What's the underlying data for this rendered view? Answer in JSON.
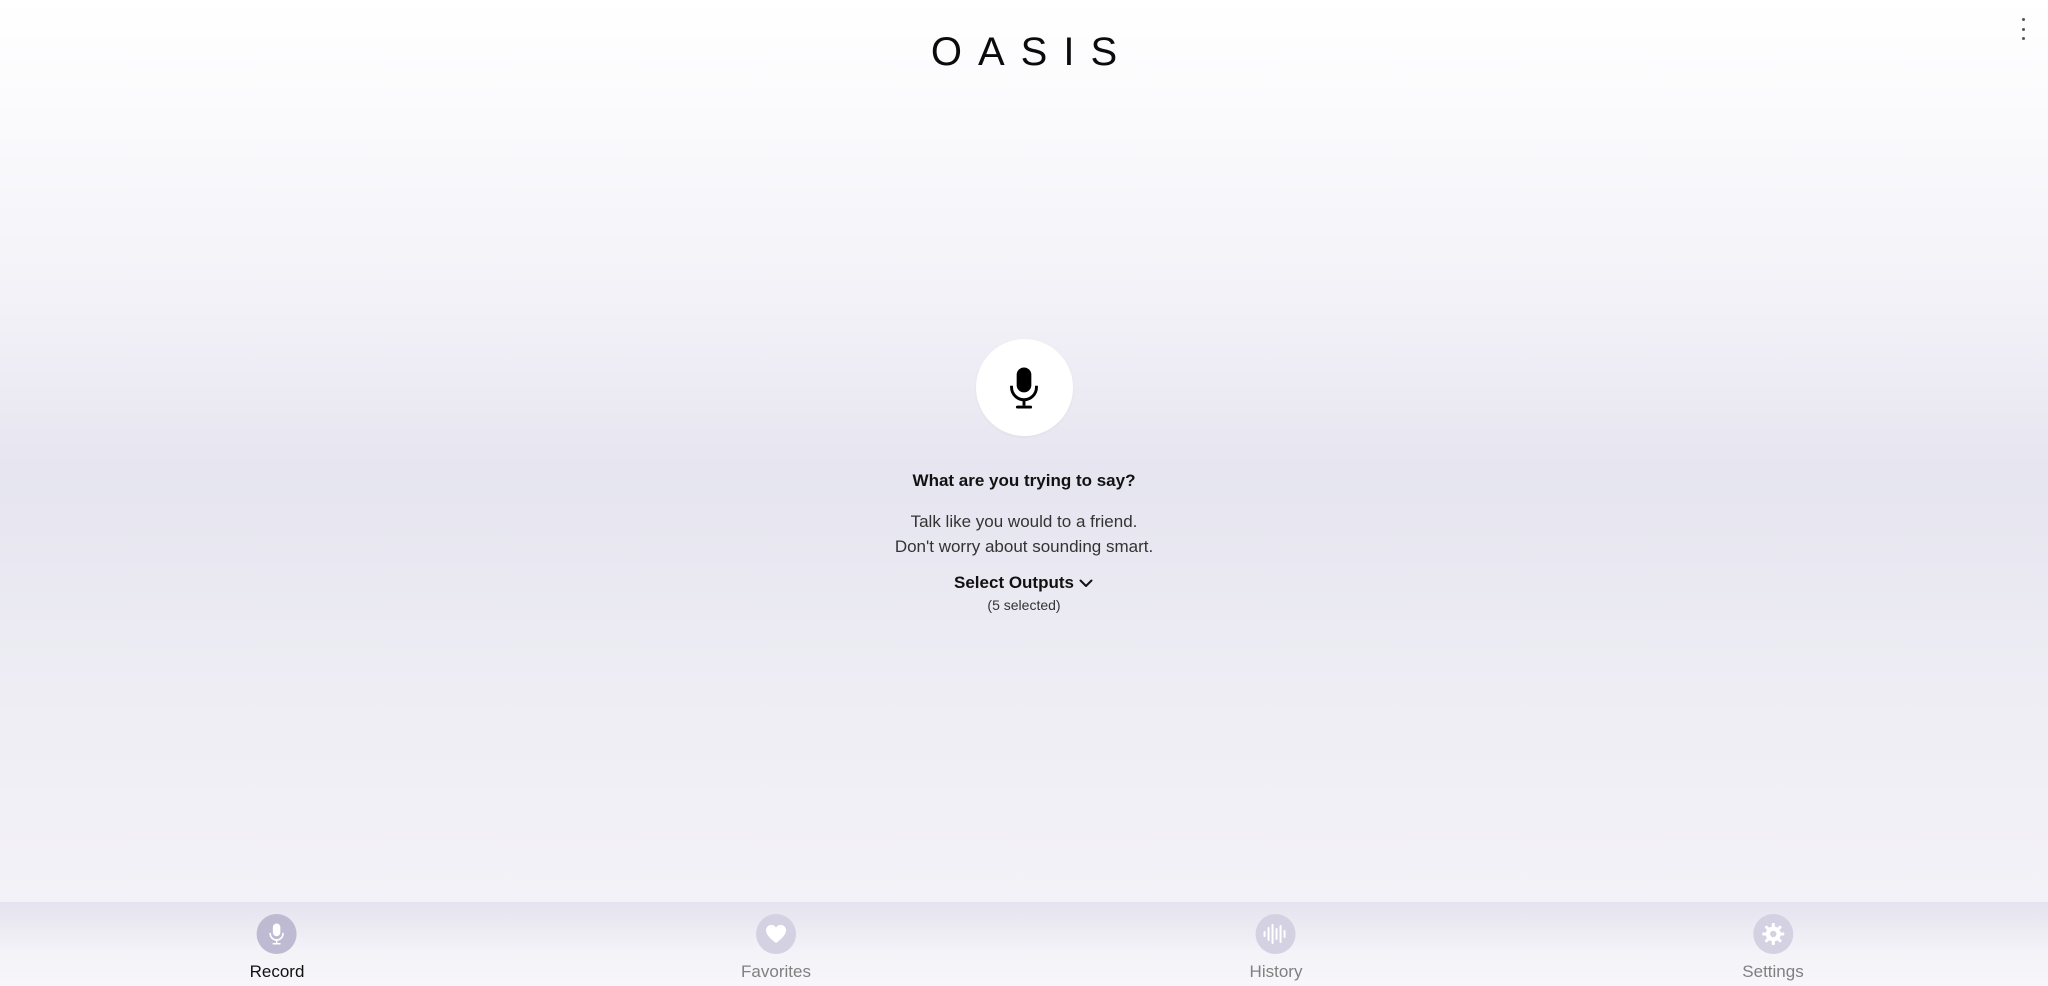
{
  "app": {
    "logo_text": "OASIS",
    "menu_icon": "more-vertical-icon"
  },
  "main": {
    "mic_icon": "microphone-icon",
    "title": "What are you trying to say?",
    "subtitle_line1": "Talk like you would to a friend.",
    "subtitle_line2": "Don't worry about sounding smart.",
    "select_outputs_label": "Select Outputs",
    "selected_count_text": "(5 selected)"
  },
  "bottom_nav": {
    "active": "Record",
    "items": [
      {
        "label": "Record",
        "icon": "microphone-icon"
      },
      {
        "label": "Favorites",
        "icon": "heart-icon"
      },
      {
        "label": "History",
        "icon": "waveform-icon"
      },
      {
        "label": "Settings",
        "icon": "gear-icon"
      }
    ]
  },
  "colors": {
    "nav_icon_bg": "#d3d1e2",
    "nav_icon_active_bg": "#bdbad2",
    "text_primary": "#111111",
    "text_muted": "#808080"
  }
}
